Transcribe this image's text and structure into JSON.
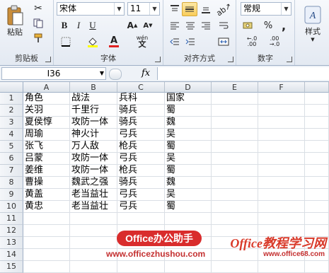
{
  "ribbon": {
    "clipboard": {
      "paste_label": "粘贴",
      "group_label": "剪贴板"
    },
    "font": {
      "font_name": "宋体",
      "font_size": "11",
      "group_label": "字体",
      "bold": "B",
      "italic": "I",
      "underline": "U",
      "wen_label": "wén"
    },
    "alignment": {
      "group_label": "对齐方式"
    },
    "number": {
      "format": "常规",
      "percent": "%",
      "comma": ",",
      "group_label": "数字"
    },
    "styles": {
      "label": "样式"
    }
  },
  "formula_bar": {
    "name_box": "I36",
    "fx": "fx",
    "formula": ""
  },
  "columns": [
    "A",
    "B",
    "C",
    "D",
    "E",
    "F"
  ],
  "rows": [
    "1",
    "2",
    "3",
    "4",
    "5",
    "6",
    "7",
    "8",
    "9",
    "10",
    "11",
    "12",
    "13",
    "14",
    "15"
  ],
  "table": [
    [
      "角色",
      "战法",
      "兵科",
      "国家"
    ],
    [
      "关羽",
      "千里行",
      "骑兵",
      "蜀"
    ],
    [
      "夏侯惇",
      "攻防一体",
      "骑兵",
      "魏"
    ],
    [
      "周瑜",
      "神火计",
      "弓兵",
      "吴"
    ],
    [
      "张飞",
      "万人敌",
      "枪兵",
      "蜀"
    ],
    [
      "吕蒙",
      "攻防一体",
      "弓兵",
      "吴"
    ],
    [
      "姜维",
      "攻防一体",
      "枪兵",
      "蜀"
    ],
    [
      "曹操",
      "魏武之强",
      "骑兵",
      "魏"
    ],
    [
      "黄盖",
      "老当益壮",
      "弓兵",
      "吴"
    ],
    [
      "黄忠",
      "老当益壮",
      "弓兵",
      "蜀"
    ]
  ],
  "watermark": {
    "badge": "Office办公助手",
    "url": "www.officezhushou.com",
    "brand": "Office教程学习网",
    "brand_url": "www.office68.com"
  }
}
